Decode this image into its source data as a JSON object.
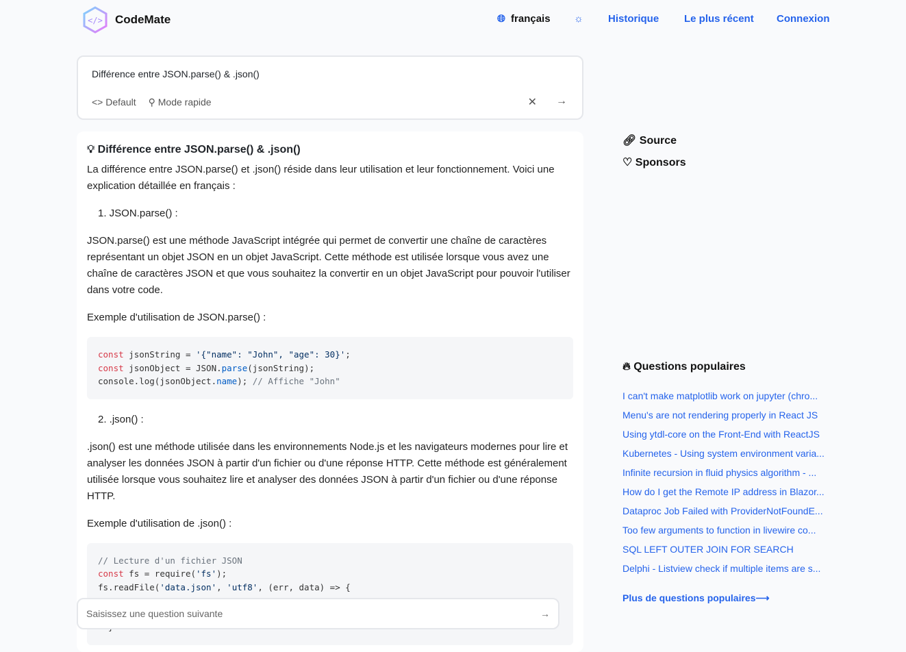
{
  "header": {
    "brand": "CodeMate",
    "language": "français",
    "nav": [
      "Historique",
      "Le plus récent",
      "Connexion"
    ]
  },
  "query": {
    "text": "Différence entre JSON.parse() & .json()",
    "mode": "Default",
    "speed": "Mode rapide"
  },
  "answer": {
    "title": "Différence entre JSON.parse() & .json()",
    "intro": "La différence entre JSON.parse() et .json() réside dans leur utilisation et leur fonctionnement. Voici une explication détaillée en français :",
    "item1": "1. JSON.parse() :",
    "p1": "JSON.parse() est une méthode JavaScript intégrée qui permet de convertir une chaîne de caractères représentant un objet JSON en un objet JavaScript. Cette méthode est utilisée lorsque vous avez une chaîne de caractères JSON et que vous souhaitez la convertir en un objet JavaScript pour pouvoir l'utiliser dans votre code.",
    "ex1": "Exemple d'utilisation de JSON.parse() :",
    "item2": "2. .json() :",
    "p2": ".json() est une méthode utilisée dans les environnements Node.js et les navigateurs modernes pour lire et analyser les données JSON à partir d'un fichier ou d'une réponse HTTP. Cette méthode est généralement utilisée lorsque vous souhaitez lire et analyser des données JSON à partir d'un fichier ou d'une réponse HTTP.",
    "ex2": "Exemple d'utilisation de .json() :"
  },
  "follow_placeholder": "Saisissez une question suivante",
  "sidebar": {
    "source": "Source",
    "sponsors": "Sponsors",
    "popular_title": "Questions populaires",
    "questions": [
      "I can't make matplotlib work on jupyter (chro...",
      "Menu's are not rendering properly in React JS",
      "Using ytdl-core on the Front-End with ReactJS",
      "Kubernetes - Using system environment varia...",
      "Infinite recursion in fluid physics algorithm - ...",
      "How do I get the Remote IP address in Blazor...",
      "Dataproc Job Failed with ProviderNotFoundE...",
      "Too few arguments to function in livewire co...",
      "SQL LEFT OUTER JOIN FOR SEARCH",
      "Delphi - Listview check if multiple items are s..."
    ],
    "more": "Plus de questions populaires⟶"
  }
}
